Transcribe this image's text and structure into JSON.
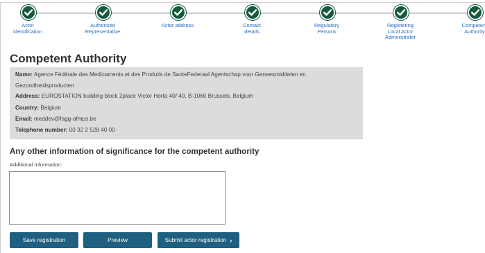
{
  "stepper": {
    "steps": [
      {
        "label": "Actor identification",
        "status": "completed"
      },
      {
        "label": "Authorised Representative",
        "status": "completed"
      },
      {
        "label": "Actor address",
        "status": "completed"
      },
      {
        "label": "Contact details",
        "status": "completed"
      },
      {
        "label": "Regulatory Persons",
        "status": "completed"
      },
      {
        "label": "Registering Local Actor Administrator",
        "status": "completed"
      },
      {
        "label": "Competent Authority",
        "status": "current"
      }
    ],
    "labels": {
      "s1a": "Actor",
      "s1b": "identification",
      "s2a": "Authorised",
      "s2b": "Representative",
      "s3a": "Actor address",
      "s4a": "Contact",
      "s4b": "details",
      "s5a": "Regulatory",
      "s5b": "Persons",
      "s6a": "Registering",
      "s6b": "Local Actor",
      "s6c": "Administrator",
      "s7a": "Competent",
      "s7b": "Authority"
    },
    "colors": {
      "done": "#165a3c",
      "label": "#2a6ebb",
      "connector": "#c8cdd1"
    }
  },
  "page_title": "Competent Authority",
  "competent_authority": {
    "name_label": "Name:",
    "name_value_line1": "Agence Fédérale des Medicaments et des Produits de SanteFederaal Agentschap voor Geneesmiddelen en",
    "name_value_line2": "Gezondheidsproducten",
    "address_label": "Address:",
    "address_value": "EUROSTATION building block 2place Victor Horta 40/ 40, B-1060 Brussels, Belgium",
    "country_label": "Country:",
    "country_value": "Belgium",
    "email_label": "Email:",
    "email_value": "meddev@fagg-afmps.be",
    "phone_label": "Telephone number:",
    "phone_value": "00 32 2 528 40 00"
  },
  "other_info": {
    "heading": "Any other information of significance for the competent authority",
    "field_label": "Additional Information:",
    "field_value": "",
    "placeholder": ""
  },
  "buttons": {
    "save": "Save registration",
    "preview": "Preview",
    "submit": "Submit actor registration",
    "submit_icon": "chevron-right-icon",
    "color": "#1f5f7f"
  }
}
